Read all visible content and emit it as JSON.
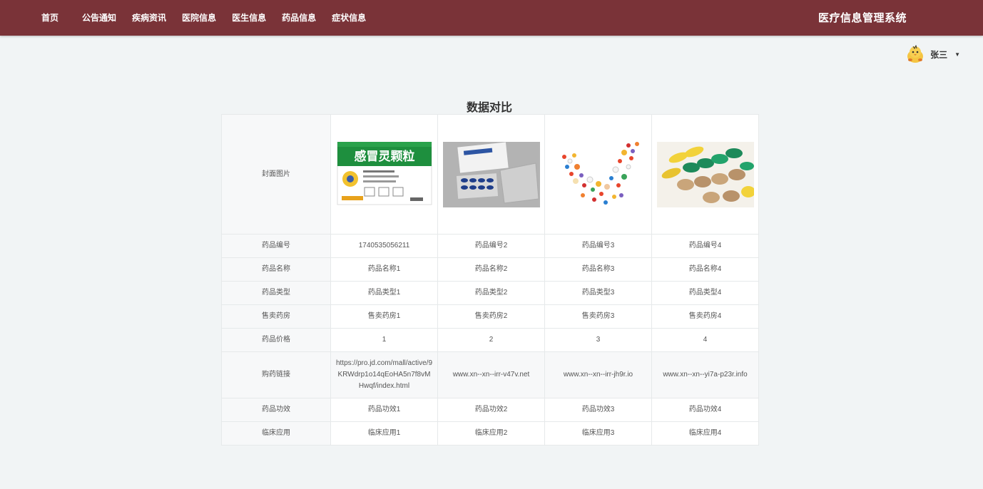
{
  "nav": {
    "items": [
      "首页",
      "公告通知",
      "疾病资讯",
      "医院信息",
      "医生信息",
      "药品信息",
      "症状信息"
    ]
  },
  "header": {
    "title": "医疗信息管理系统"
  },
  "user": {
    "name": "张三",
    "avatar_icon": "cartoon-chick-avatar",
    "caret_icon": "caret-down-icon"
  },
  "page": {
    "title": "数据对比"
  },
  "compare": {
    "row_labels": [
      "封面图片",
      "药品编号",
      "药品名称",
      "药品类型",
      "售卖药房",
      "药品价格",
      "购药链接",
      "药品功效",
      "临床应用"
    ],
    "columns": [
      {
        "image": "感冒灵颗粒",
        "id": "1740535056211",
        "name": "药品名称1",
        "type": "药品类型1",
        "pharmacy": "售卖药房1",
        "price": "1",
        "link": "https://pro.jd.com/mall/active/9KRWdrp1o14qEoHA5n7f8vMHwqf/index.html",
        "effect": "药品功效1",
        "clinical": "临床应用1"
      },
      {
        "image": "",
        "id": "药品编号2",
        "name": "药品名称2",
        "type": "药品类型2",
        "pharmacy": "售卖药房2",
        "price": "2",
        "link": "www.xn--xn--irr-v47v.net",
        "effect": "药品功效2",
        "clinical": "临床应用2"
      },
      {
        "image": "",
        "id": "药品编号3",
        "name": "药品名称3",
        "type": "药品类型3",
        "pharmacy": "售卖药房3",
        "price": "3",
        "link": "www.xn--xn--irr-jh9r.io",
        "effect": "药品功效3",
        "clinical": "临床应用3"
      },
      {
        "image": "",
        "id": "药品编号4",
        "name": "药品名称4",
        "type": "药品类型4",
        "pharmacy": "售卖药房4",
        "price": "4",
        "link": "www.xn--xn--yi7a-p23r.info",
        "effect": "药品功效4",
        "clinical": "临床应用4"
      }
    ]
  },
  "colors": {
    "topbar": "#7a3338",
    "background": "#f1f4f5",
    "table_head": "#f7f8f9"
  }
}
